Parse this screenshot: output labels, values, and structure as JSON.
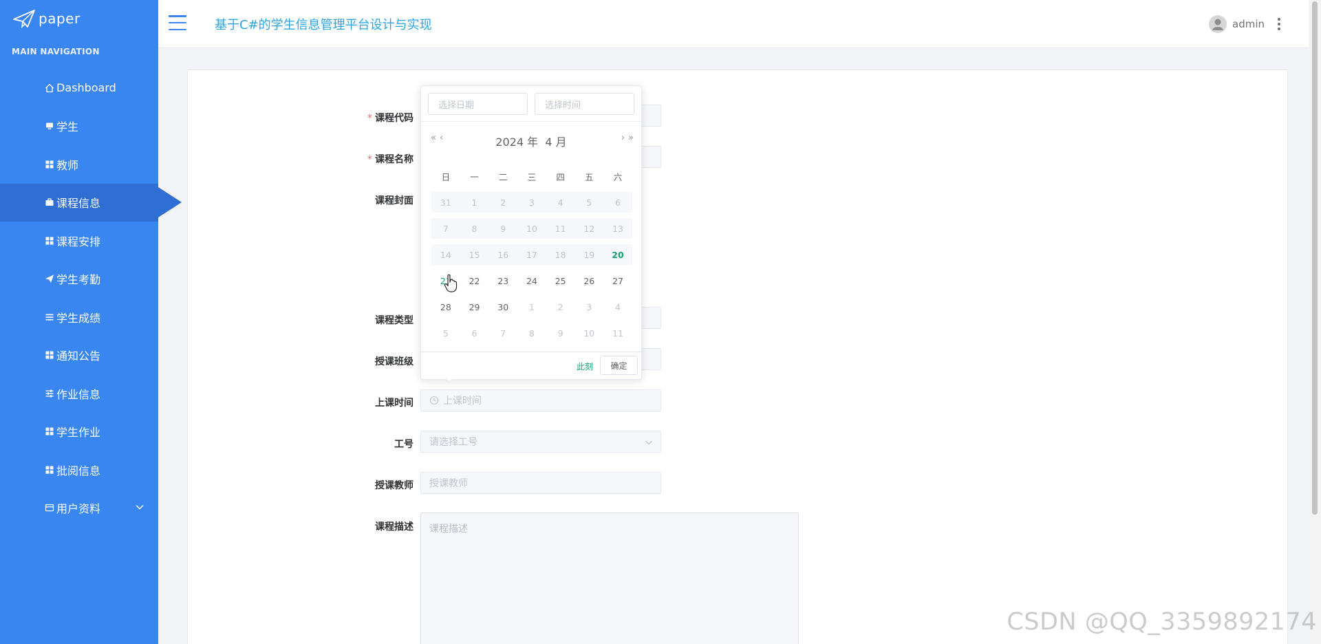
{
  "sidebar": {
    "logo_text": "paper",
    "nav_heading": "MAIN NAVIGATION",
    "items": [
      {
        "label": "Dashboard",
        "icon": "home-icon"
      },
      {
        "label": "学生",
        "icon": "monitor-icon"
      },
      {
        "label": "教师",
        "icon": "grid-icon"
      },
      {
        "label": "课程信息",
        "icon": "briefcase-icon"
      },
      {
        "label": "课程安排",
        "icon": "grid-icon"
      },
      {
        "label": "学生考勤",
        "icon": "paper-plane-icon"
      },
      {
        "label": "学生成绩",
        "icon": "list-icon"
      },
      {
        "label": "通知公告",
        "icon": "grid-icon"
      },
      {
        "label": "作业信息",
        "icon": "sliders-icon"
      },
      {
        "label": "学生作业",
        "icon": "grid-icon"
      },
      {
        "label": "批阅信息",
        "icon": "grid-icon"
      },
      {
        "label": "用户资料",
        "icon": "card-icon"
      }
    ],
    "active_item": "课程信息",
    "accent": "#3a86f0",
    "active_bg": "#2f6fd3"
  },
  "header": {
    "title": "基于C#的学生信息管理平台设计与实现",
    "user_name": "admin"
  },
  "form": {
    "labels": {
      "course_code": "课程代码",
      "course_name": "课程名称",
      "course_cover": "课程封面",
      "course_type": "课程类型",
      "class": "授课班级",
      "class_time": "上课时间",
      "job_number": "工号",
      "teacher": "授课教师",
      "description": "课程描述"
    },
    "required_mark": "*",
    "placeholders": {
      "class_time": "上课时间",
      "job_number": "请选择工号",
      "teacher": "授课教师",
      "description": "课程描述"
    }
  },
  "datepicker": {
    "date_placeholder": "选择日期",
    "time_placeholder": "选择时间",
    "prev_year": "«",
    "prev_month": "‹",
    "next_month": "›",
    "next_year": "»",
    "year": "2024",
    "year_unit": "年",
    "month": "4",
    "month_unit": "月",
    "weekdays": [
      "日",
      "一",
      "二",
      "三",
      "四",
      "五",
      "六"
    ],
    "weeks": [
      [
        {
          "d": "31",
          "s": "disabled"
        },
        {
          "d": "1",
          "s": "disabled"
        },
        {
          "d": "2",
          "s": "disabled"
        },
        {
          "d": "3",
          "s": "disabled"
        },
        {
          "d": "4",
          "s": "disabled"
        },
        {
          "d": "5",
          "s": "disabled"
        },
        {
          "d": "6",
          "s": "disabled"
        }
      ],
      [
        {
          "d": "7",
          "s": "disabled"
        },
        {
          "d": "8",
          "s": "disabled"
        },
        {
          "d": "9",
          "s": "disabled"
        },
        {
          "d": "10",
          "s": "disabled"
        },
        {
          "d": "11",
          "s": "disabled"
        },
        {
          "d": "12",
          "s": "disabled"
        },
        {
          "d": "13",
          "s": "disabled"
        }
      ],
      [
        {
          "d": "14",
          "s": "disabled"
        },
        {
          "d": "15",
          "s": "disabled"
        },
        {
          "d": "16",
          "s": "disabled"
        },
        {
          "d": "17",
          "s": "disabled"
        },
        {
          "d": "18",
          "s": "disabled"
        },
        {
          "d": "19",
          "s": "disabled"
        },
        {
          "d": "20",
          "s": "today"
        }
      ],
      [
        {
          "d": "21",
          "s": "hover"
        },
        {
          "d": "22",
          "s": ""
        },
        {
          "d": "23",
          "s": ""
        },
        {
          "d": "24",
          "s": ""
        },
        {
          "d": "25",
          "s": ""
        },
        {
          "d": "26",
          "s": ""
        },
        {
          "d": "27",
          "s": ""
        }
      ],
      [
        {
          "d": "28",
          "s": ""
        },
        {
          "d": "29",
          "s": ""
        },
        {
          "d": "30",
          "s": ""
        },
        {
          "d": "1",
          "s": "other"
        },
        {
          "d": "2",
          "s": "other"
        },
        {
          "d": "3",
          "s": "other"
        },
        {
          "d": "4",
          "s": "other"
        }
      ],
      [
        {
          "d": "5",
          "s": "other"
        },
        {
          "d": "6",
          "s": "other"
        },
        {
          "d": "7",
          "s": "other"
        },
        {
          "d": "8",
          "s": "other"
        },
        {
          "d": "9",
          "s": "other"
        },
        {
          "d": "10",
          "s": "other"
        },
        {
          "d": "11",
          "s": "other"
        }
      ]
    ],
    "now_label": "此刻",
    "ok_label": "确定",
    "today_color": "#13a36b"
  },
  "watermark": "CSDN @QQ_3359892174"
}
